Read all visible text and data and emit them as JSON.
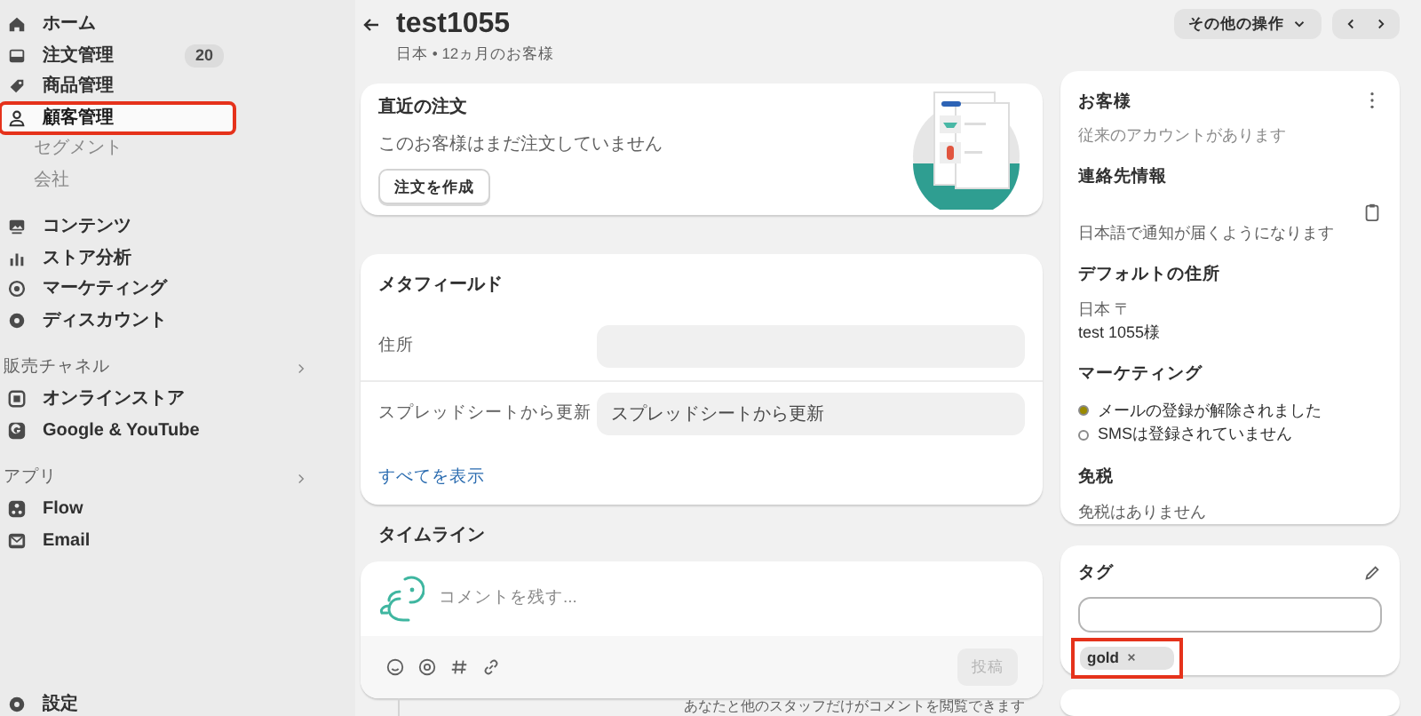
{
  "sidebar": {
    "sections": [
      {
        "items": [
          {
            "label": "ホーム",
            "selected": false,
            "highlighted": false
          },
          {
            "label": "注文管理",
            "badge": "20",
            "selected": false,
            "highlighted": false
          },
          {
            "label": "商品管理",
            "selected": false,
            "highlighted": false
          },
          {
            "label": "顧客管理",
            "selected": true,
            "highlighted": true,
            "children": [
              {
                "label": "セグメント"
              },
              {
                "label": "会社"
              }
            ]
          }
        ]
      },
      {
        "items": [
          {
            "label": "コンテンツ",
            "selected": false,
            "highlighted": false
          },
          {
            "label": "ストア分析",
            "selected": false,
            "highlighted": false
          },
          {
            "label": "マーケティング",
            "selected": false,
            "highlighted": false
          },
          {
            "label": "ディスカウント",
            "selected": false,
            "highlighted": false
          }
        ]
      },
      {
        "heading": "販売チャネル",
        "items": [
          {
            "label": "オンラインストア",
            "selected": false,
            "highlighted": false
          },
          {
            "label": "Google & YouTube",
            "selected": false,
            "highlighted": false
          }
        ]
      },
      {
        "heading": "アプリ",
        "items": [
          {
            "label": "Flow",
            "selected": false,
            "highlighted": false
          },
          {
            "label": "Email",
            "selected": false,
            "highlighted": false
          }
        ]
      }
    ],
    "settings": "設定"
  },
  "header": {
    "title": "test1055",
    "subtitle": "日本 • 12ヵ月のお客様",
    "more_actions": "その他の操作"
  },
  "recent_orders": {
    "title": "直近の注文",
    "message": "このお客様はまだ注文していません",
    "button": "注文を作成"
  },
  "metafields": {
    "title": "メタフィールド",
    "rows": [
      {
        "label": "住所",
        "value": ""
      },
      {
        "label": "スプレッドシートから更新",
        "value": "スプレッドシートから更新"
      }
    ],
    "show_all": "すべてを表示"
  },
  "timeline": {
    "title": "タイムライン",
    "placeholder": "コメントを残す...",
    "post": "投稿",
    "note": "あなたと他のスタッフだけがコメントを閲覧できます"
  },
  "customer": {
    "title": "お客様",
    "account": "従来のアカウントがあります",
    "contact_title": "連絡先情報",
    "contact_note": "日本語で通知が届くようになります",
    "address_title": "デフォルトの住所",
    "address_lines": [
      "日本 〒",
      "test 1055様"
    ],
    "marketing_title": "マーケティング",
    "marketing": [
      {
        "label": "メールの登録が解除されました",
        "color": "#9a8a00"
      },
      {
        "label": "SMSは登録されていません",
        "color": "#ffffff"
      }
    ],
    "tax_title": "免税",
    "tax_note": "免税はありません"
  },
  "tags": {
    "title": "タグ",
    "items": [
      {
        "label": "gold",
        "highlighted": true
      }
    ]
  }
}
